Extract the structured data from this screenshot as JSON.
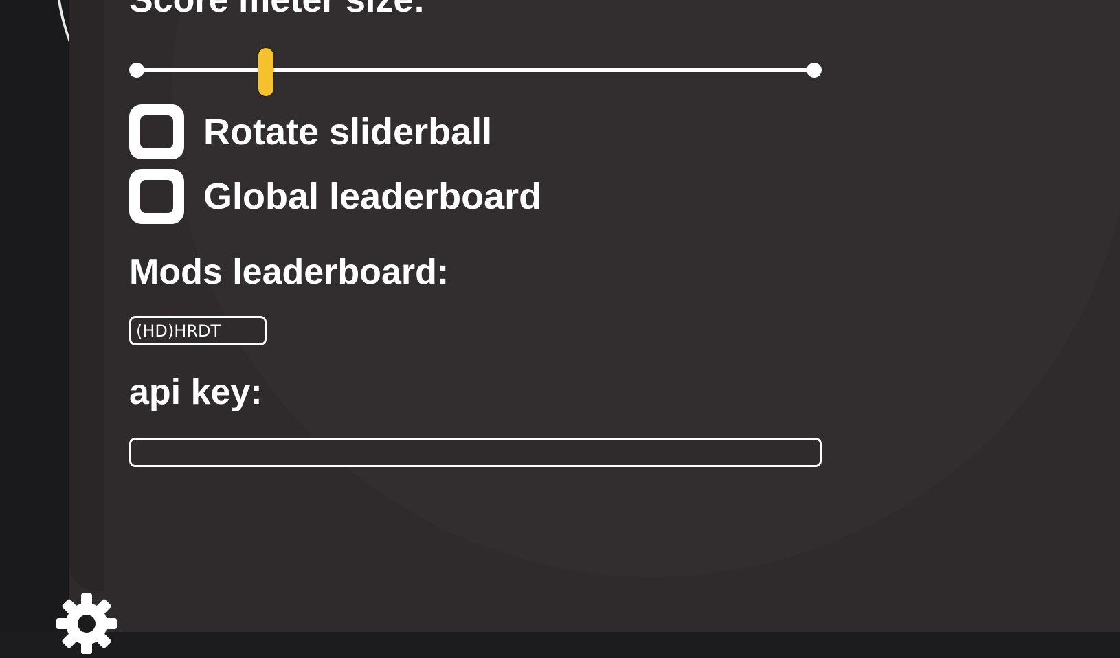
{
  "settings": {
    "score_meter_label": "Score meter size:",
    "score_meter_value": 0.19,
    "rotate_sliderball": {
      "label": "Rotate sliderball",
      "checked": false
    },
    "global_leaderboard": {
      "label": "Global leaderboard",
      "checked": false
    },
    "mods_leaderboard": {
      "label": "Mods leaderboard:",
      "value": "(HD)HRDT",
      "placeholder": ""
    },
    "api_key": {
      "label": "api key:",
      "value": "",
      "placeholder": ""
    }
  },
  "colors": {
    "accent": "#f6c12f",
    "panel_background": "#2f2b2c",
    "outer_background": "#1c1b1d"
  },
  "icons": {
    "settings": "gear-icon"
  }
}
